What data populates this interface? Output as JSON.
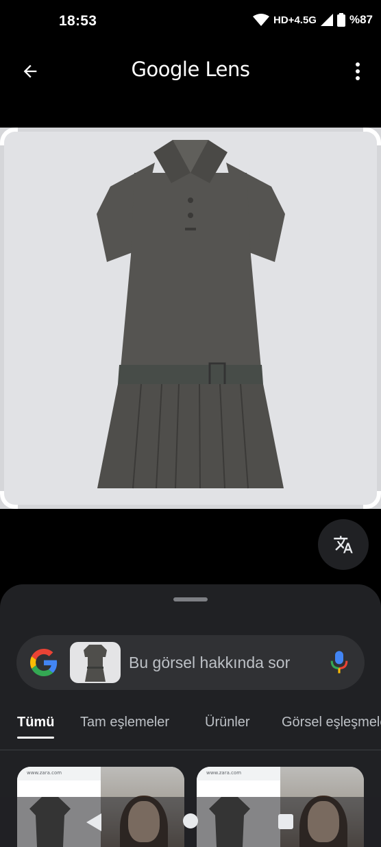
{
  "status_bar": {
    "time": "18:53",
    "network": "HD+4.5G",
    "battery": "%87",
    "icons": [
      "wifi-icon",
      "signal-icon",
      "battery-icon"
    ]
  },
  "app_bar": {
    "title": "Google Lens",
    "back_icon": "arrow-back-icon",
    "menu_icon": "more-vert-icon"
  },
  "image": {
    "subject": "product-photo",
    "icon": "translate-icon"
  },
  "search": {
    "placeholder": "Bu görsel hakkında sor"
  },
  "tabs": [
    {
      "label": "Tümü",
      "active": true
    },
    {
      "label": "Tam eşlemeler",
      "active": false
    },
    {
      "label": "Ürünler",
      "active": false
    },
    {
      "label": "Görsel eşleşmeler",
      "active": false
    }
  ],
  "results": [
    {
      "source": "www.zara.com"
    },
    {
      "source": "www.zara.com"
    }
  ],
  "colors": {
    "background": "#000000",
    "sheet": "#202124",
    "search_bar": "#303134",
    "google_blue": "#4285F4",
    "google_red": "#EA4335",
    "google_yellow": "#FBBC05",
    "google_green": "#34A853"
  }
}
